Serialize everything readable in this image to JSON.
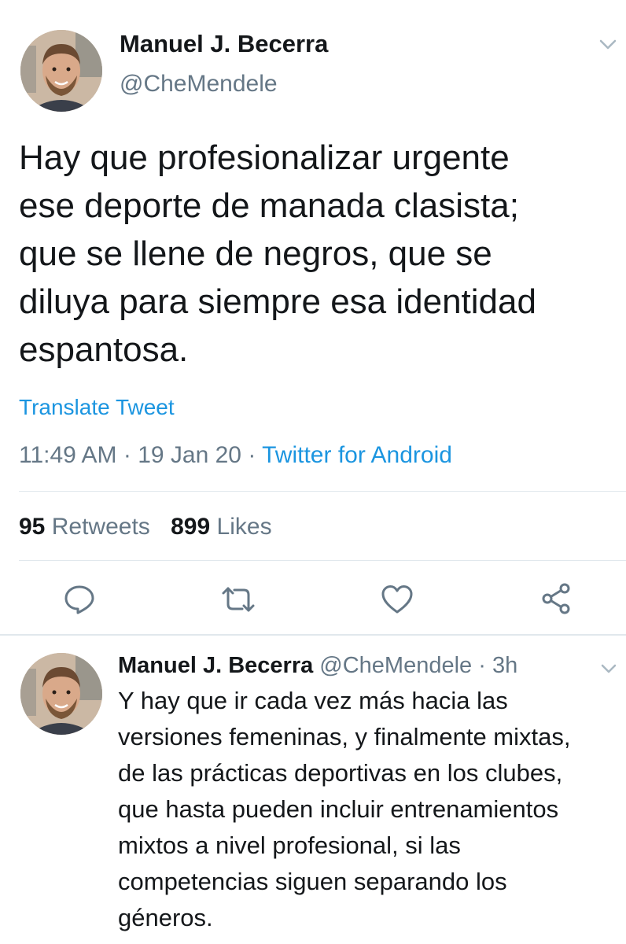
{
  "tweet": {
    "author_name": "Manuel J. Becerra",
    "author_handle": "@CheMendele",
    "text_lines": [
      "Hay que profesionalizar urgente",
      "ese deporte de manada clasista;",
      "que se llene de negros, que se",
      "diluya para siempre esa identidad",
      "espantosa."
    ],
    "translate_label": "Translate Tweet",
    "time": "11:49 AM",
    "separator": "·",
    "date": "19 Jan 20",
    "source": "Twitter for Android",
    "retweets_count": "95",
    "retweets_label": "Retweets",
    "likes_count": "899",
    "likes_label": "Likes",
    "actions": [
      "reply-icon",
      "retweet-icon",
      "like-icon",
      "share-icon"
    ]
  },
  "reply": {
    "author_name": "Manuel J. Becerra",
    "author_handle": "@CheMendele",
    "separator": "·",
    "age": "3h",
    "text_lines": [
      "Y hay que ir cada vez más hacia las",
      "versiones femeninas, y finalmente mixtas,",
      "de las prácticas deportivas en los clubes,",
      "que hasta pueden incluir entrenamientos",
      "mixtos a nivel profesional, si las",
      "competencias siguen separando los",
      "géneros."
    ]
  },
  "colors": {
    "link": "#1b95e0",
    "muted": "#657786",
    "text": "#14171a",
    "divider": "#e1e8ed"
  }
}
